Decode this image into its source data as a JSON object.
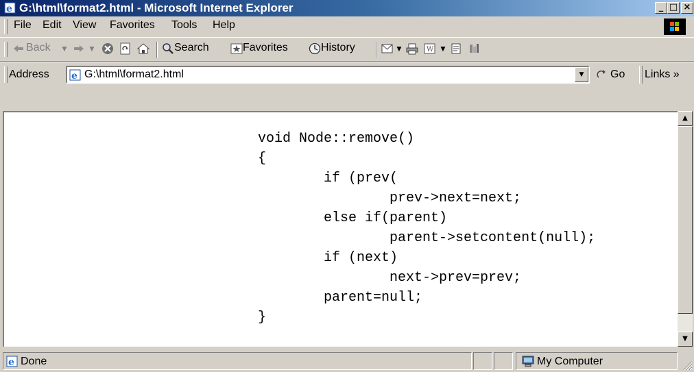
{
  "window": {
    "title": "G:\\html\\format2.html - Microsoft Internet Explorer",
    "controls": {
      "minimize": "_",
      "maximize": "□",
      "close": "×"
    }
  },
  "menu": [
    "File",
    "Edit",
    "View",
    "Favorites",
    "Tools",
    "Help"
  ],
  "toolbar": {
    "back": "Back",
    "search": "Search",
    "favorites": "Favorites",
    "history": "History"
  },
  "address": {
    "label": "Address",
    "value": "G:\\html\\format2.html",
    "go": "Go",
    "links": "Links »"
  },
  "content": {
    "code": "void Node::remove()\n{\n        if (prev(\n                prev->next=next;\n        else if(parent)\n                parent->setcontent(null);\n        if (next)\n                next->prev=prev;\n        parent=null;\n}"
  },
  "status": {
    "text": "Done",
    "zone": "My Computer"
  },
  "colors": {
    "titlebar_start": "#0a246a",
    "titlebar_end": "#a6caf0",
    "chrome": "#d4d0c8"
  },
  "icons": [
    "ie-page-icon",
    "back-arrow-icon",
    "forward-arrow-icon",
    "stop-icon",
    "refresh-icon",
    "home-icon",
    "search-icon",
    "favorites-icon",
    "history-icon",
    "mail-icon",
    "print-icon",
    "edit-icon",
    "discuss-icon",
    "messenger-icon",
    "go-arrow-icon",
    "my-computer-icon",
    "windows-logo-icon"
  ]
}
